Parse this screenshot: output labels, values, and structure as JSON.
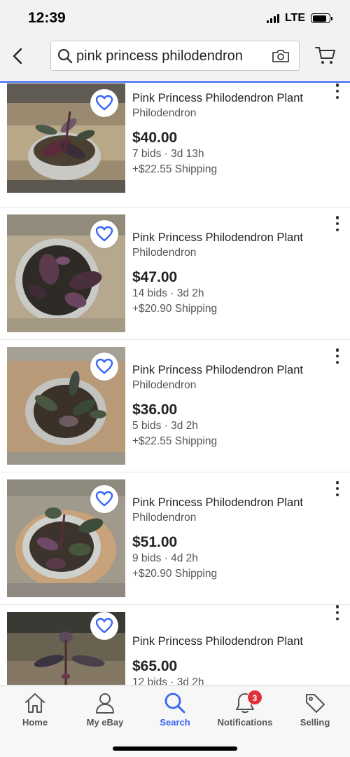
{
  "status_bar": {
    "time": "12:39",
    "network": "LTE"
  },
  "search": {
    "query": "pink princess philodendron"
  },
  "listings": [
    {
      "title": "Pink Princess Philodendron Plant",
      "subtitle": "Philodendron",
      "price": "$40.00",
      "bids": "7 bids · 3d 13h",
      "shipping": "+$22.55 Shipping"
    },
    {
      "title": "Pink Princess Philodendron Plant",
      "subtitle": "Philodendron",
      "price": "$47.00",
      "bids": "14 bids · 3d 2h",
      "shipping": "+$20.90 Shipping"
    },
    {
      "title": "Pink Princess Philodendron Plant",
      "subtitle": "Philodendron",
      "price": "$36.00",
      "bids": "5 bids · 3d 2h",
      "shipping": "+$22.55 Shipping"
    },
    {
      "title": "Pink Princess Philodendron Plant",
      "subtitle": "Philodendron",
      "price": "$51.00",
      "bids": "9 bids · 4d 2h",
      "shipping": "+$20.90 Shipping"
    },
    {
      "title": "Pink Princess Philodendron Plant",
      "subtitle": "",
      "price": "$65.00",
      "bids": "12 bids · 3d 2h",
      "shipping": ""
    }
  ],
  "tab_bar": {
    "tabs": [
      {
        "label": "Home",
        "icon": "home-icon"
      },
      {
        "label": "My eBay",
        "icon": "user-icon"
      },
      {
        "label": "Search",
        "icon": "search-icon"
      },
      {
        "label": "Notifications",
        "icon": "bell-icon"
      },
      {
        "label": "Selling",
        "icon": "tag-icon"
      }
    ],
    "notifications_badge": "3"
  },
  "colors": {
    "accent": "#3665f3",
    "badge": "#e0313a",
    "header_bg": "#f2f2f2"
  }
}
